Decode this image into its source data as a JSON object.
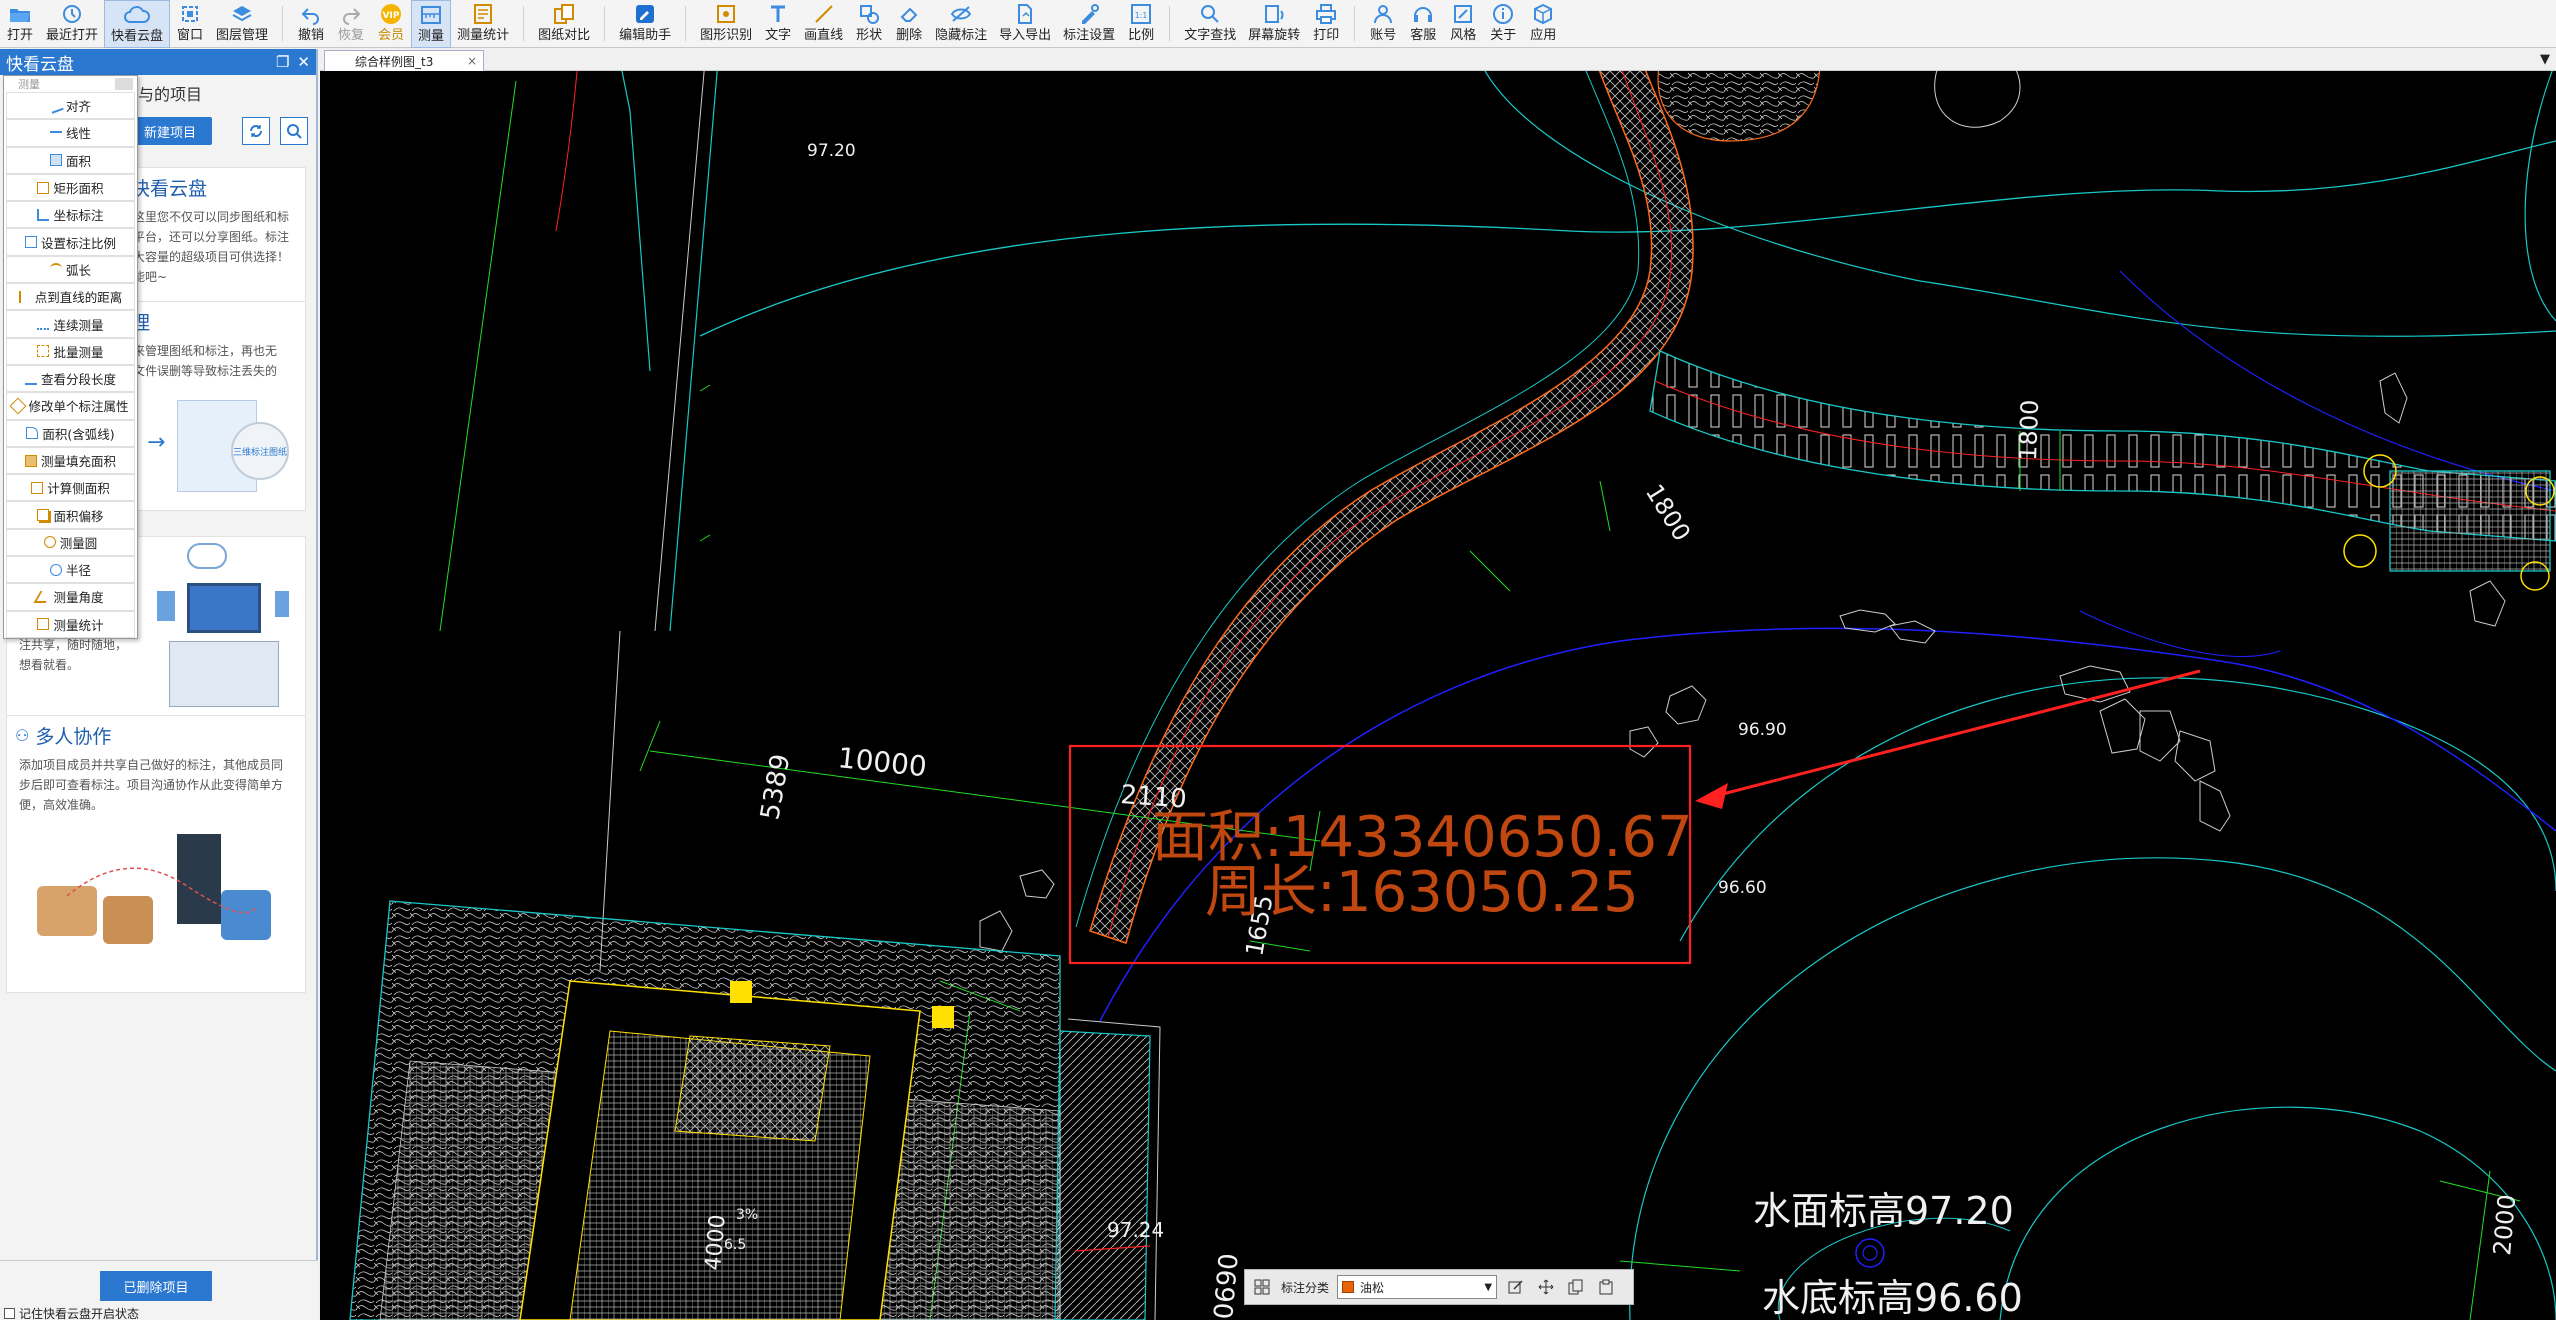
{
  "toolbar": {
    "items": [
      {
        "id": "open",
        "label": "打开",
        "icon": "folder-open-icon"
      },
      {
        "id": "recent",
        "label": "最近打开",
        "icon": "clock-icon"
      },
      {
        "id": "cloud",
        "label": "快看云盘",
        "icon": "cloud-icon"
      },
      {
        "id": "window",
        "label": "窗口",
        "icon": "window-icon"
      },
      {
        "id": "layers",
        "label": "图层管理",
        "icon": "layers-icon"
      },
      {
        "id": "undo",
        "label": "撤销",
        "icon": "undo-icon"
      },
      {
        "id": "redo",
        "label": "恢复",
        "icon": "redo-icon"
      },
      {
        "id": "vip",
        "label": "会员",
        "icon": "vip-icon"
      },
      {
        "id": "measure",
        "label": "测量",
        "icon": "measure-icon"
      },
      {
        "id": "measure-stats",
        "label": "测量统计",
        "icon": "stats-icon"
      },
      {
        "id": "compare",
        "label": "图纸对比",
        "icon": "compare-icon"
      },
      {
        "id": "edit-helper",
        "label": "编辑助手",
        "icon": "edit-helper-icon"
      },
      {
        "id": "recognize",
        "label": "图形识别",
        "icon": "recognize-icon"
      },
      {
        "id": "text",
        "label": "文字",
        "icon": "text-icon"
      },
      {
        "id": "line",
        "label": "画直线",
        "icon": "line-icon"
      },
      {
        "id": "shape",
        "label": "形状",
        "icon": "shape-icon"
      },
      {
        "id": "delete",
        "label": "删除",
        "icon": "eraser-icon"
      },
      {
        "id": "hide-marks",
        "label": "隐藏标注",
        "icon": "eye-off-icon"
      },
      {
        "id": "import-export",
        "label": "导入导出",
        "icon": "import-export-icon"
      },
      {
        "id": "mark-settings",
        "label": "标注设置",
        "icon": "mark-settings-icon"
      },
      {
        "id": "scale",
        "label": "比例",
        "icon": "scale-icon"
      },
      {
        "id": "find-text",
        "label": "文字查找",
        "icon": "find-text-icon"
      },
      {
        "id": "rotate",
        "label": "屏幕旋转",
        "icon": "rotate-icon"
      },
      {
        "id": "print",
        "label": "打印",
        "icon": "printer-icon"
      },
      {
        "id": "account",
        "label": "账号",
        "icon": "user-icon"
      },
      {
        "id": "service",
        "label": "客服",
        "icon": "headset-icon"
      },
      {
        "id": "style",
        "label": "风格",
        "icon": "style-icon"
      },
      {
        "id": "about",
        "label": "关于",
        "icon": "info-icon"
      },
      {
        "id": "apps",
        "label": "应用",
        "icon": "apps-icon"
      }
    ]
  },
  "panel": {
    "title": "快看云盘",
    "subtitle": "与的项目",
    "new_project": "新建项目",
    "card1": {
      "title": "快看云盘",
      "text": "这里您不仅可以同步图纸和标\n平台，还可以分享图纸。标注\n大容量的超级项目可供选择！\n能吧~"
    },
    "card2": {
      "title": "理",
      "text": "来管理图纸和标注，再也无\n文件误删等导致标注丢失的"
    },
    "card2_img_text": "三维标注图纸",
    "card3": {
      "text": "注共享，随时随地，\n想看就看。"
    },
    "card4": {
      "title": "多人协作",
      "text": "添加项目成员并共享自己做好的标注，其他成员同\n步后即可查看标注。项目沟通协作从此变得简单方\n便，高效准确。"
    },
    "deleted_projects": "已删除项目",
    "remember_state": "记住快看云盘开启状态"
  },
  "measure_menu": {
    "header": "测量",
    "items": [
      "对齐",
      "线性",
      "面积",
      "矩形面积",
      "坐标标注",
      "设置标注比例",
      "弧长",
      "点到直线的距离",
      "连续测量",
      "批量测量",
      "查看分段长度",
      "修改单个标注属性",
      "面积(含弧线)",
      "测量填充面积",
      "计算侧面积",
      "面积偏移",
      "测量圆",
      "半径",
      "测量角度",
      "测量统计"
    ]
  },
  "tab": {
    "name": "综合样例图_t3",
    "close": "×",
    "more": "▼"
  },
  "drawing": {
    "elev_1": "97.20",
    "elev_2": "96.90",
    "elev_3": "96.60",
    "elev_4": "97.24",
    "dim_10000": "10000",
    "dim_5389": "5389",
    "dim_2110": "2110",
    "dim_1655": "1655",
    "dim_1800a": "1800",
    "dim_1800b": "1800",
    "dim_2000": "2000",
    "dim_0690": "0690",
    "dim_4000": "4000",
    "slope": "3%",
    "small_65": "6.5",
    "area_label": "面积:143340650.67",
    "perimeter_label": "周长:163050.25",
    "water_surface": "水面标高97.20",
    "water_bottom": "水底标高96.60"
  },
  "float_bar": {
    "label": "标注分类",
    "category": "油松",
    "category_color": "#e8630a"
  },
  "colors": {
    "accent": "#2b78d0",
    "canvas": "#000000",
    "cad_cyan": "#18c8c8",
    "cad_green": "#22dd22",
    "cad_blue": "#2020ff",
    "cad_orange": "#ff6a1a",
    "cad_yellow": "#ffe000",
    "measure_red": "#ff2020",
    "measure_text": "#c04810"
  }
}
